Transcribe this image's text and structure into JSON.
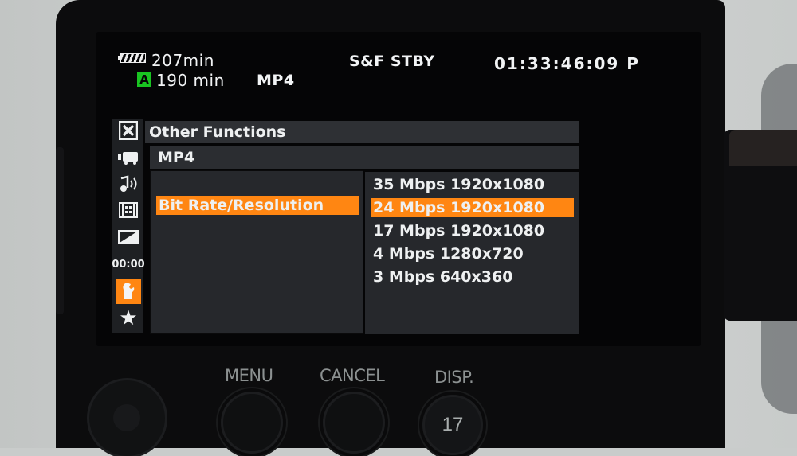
{
  "status_bar": {
    "battery_icon": "battery-full-icon",
    "battery_remaining": "207min",
    "media_slot": "A",
    "media_remaining": "190 min",
    "format": "MP4",
    "recording_status": "S&F STBY",
    "timecode": "01:33:46:09 P"
  },
  "sidebar": {
    "items": [
      {
        "icon": "close-icon",
        "glyph": "✕"
      },
      {
        "icon": "camera-icon",
        "glyph": "▰"
      },
      {
        "icon": "audio-icon",
        "glyph": "♪"
      },
      {
        "icon": "video-setup-icon",
        "glyph": "▦"
      },
      {
        "icon": "lcd-setup-icon",
        "glyph": "◩"
      },
      {
        "icon": "timecode-icon",
        "glyph": "00:00"
      },
      {
        "icon": "wrench-icon",
        "glyph": "🔧",
        "active": true
      },
      {
        "icon": "star-icon",
        "glyph": "★"
      }
    ]
  },
  "menu": {
    "title": "Other Functions",
    "submenu": "MP4",
    "setting": "Bit Rate/Resolution",
    "options": [
      {
        "label": "35 Mbps 1920x1080",
        "selected": false
      },
      {
        "label": "24 Mbps 1920x1080",
        "selected": true
      },
      {
        "label": "17 Mbps 1920x1080",
        "selected": false
      },
      {
        "label": "4 Mbps 1280x720",
        "selected": false
      },
      {
        "label": "3 Mbps 640x360",
        "selected": false
      }
    ]
  },
  "buttons": {
    "menu": "MENU",
    "cancel": "CANCEL",
    "disp": "DISP.",
    "disp_number": "17"
  },
  "colors": {
    "highlight": "#ff8612",
    "media_badge": "#19c421",
    "panel": "#26282c"
  }
}
